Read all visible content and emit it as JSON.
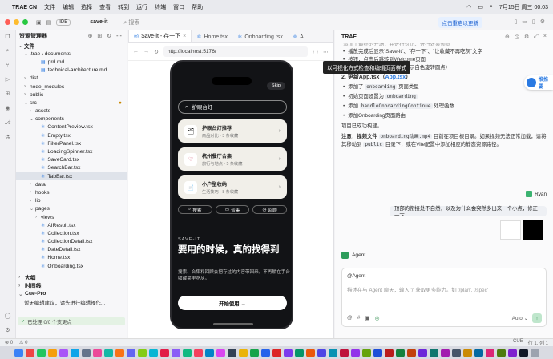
{
  "menubar": {
    "app": "TRAE CN",
    "items": [
      "文件",
      "编辑",
      "选择",
      "查看",
      "转到",
      "运行",
      "终端",
      "窗口",
      "帮助"
    ],
    "datetime": "7月15日 周三 00:03"
  },
  "titlebar": {
    "ide": "IDE",
    "project": "save-it",
    "search": "搜索",
    "update": "点击重启以更新"
  },
  "explorer": {
    "title": "资源管理器",
    "rows": [
      {
        "label": "文件",
        "depth": 0,
        "caret": "⌄",
        "type": "section"
      },
      {
        "label": ".trae \\ documents",
        "depth": 1,
        "caret": "⌄",
        "type": "folder"
      },
      {
        "label": "prd.md",
        "depth": 3,
        "caret": "",
        "type": "md"
      },
      {
        "label": "technical-architecture.md",
        "depth": 3,
        "caret": "",
        "type": "md"
      },
      {
        "label": "dist",
        "depth": 1,
        "caret": "›",
        "type": "folder"
      },
      {
        "label": "node_modules",
        "depth": 1,
        "caret": "›",
        "type": "folder"
      },
      {
        "label": "public",
        "depth": 1,
        "caret": "›",
        "type": "folder"
      },
      {
        "label": "src",
        "depth": 1,
        "caret": "⌄",
        "type": "folder",
        "modified": true
      },
      {
        "label": "assets",
        "depth": 2,
        "caret": "›",
        "type": "folder"
      },
      {
        "label": "components",
        "depth": 2,
        "caret": "⌄",
        "type": "folder"
      },
      {
        "label": "ContentPreview.tsx",
        "depth": 3,
        "caret": "",
        "type": "tsx"
      },
      {
        "label": "Empty.tsx",
        "depth": 3,
        "caret": "",
        "type": "tsx"
      },
      {
        "label": "FilterPanel.tsx",
        "depth": 3,
        "caret": "",
        "type": "tsx"
      },
      {
        "label": "LoadingSpinner.tsx",
        "depth": 3,
        "caret": "",
        "type": "tsx"
      },
      {
        "label": "SaveCard.tsx",
        "depth": 3,
        "caret": "",
        "type": "tsx"
      },
      {
        "label": "SearchBar.tsx",
        "depth": 3,
        "caret": "",
        "type": "tsx"
      },
      {
        "label": "TabBar.tsx",
        "depth": 3,
        "caret": "",
        "type": "tsx",
        "selected": true
      },
      {
        "label": "data",
        "depth": 2,
        "caret": "›",
        "type": "folder"
      },
      {
        "label": "hooks",
        "depth": 2,
        "caret": "›",
        "type": "folder"
      },
      {
        "label": "lib",
        "depth": 2,
        "caret": "›",
        "type": "folder"
      },
      {
        "label": "pages",
        "depth": 2,
        "caret": "⌄",
        "type": "folder"
      },
      {
        "label": "views",
        "depth": 3,
        "caret": "›",
        "type": "folder"
      },
      {
        "label": "AIResult.tsx",
        "depth": 3,
        "caret": "",
        "type": "tsx"
      },
      {
        "label": "Collection.tsx",
        "depth": 3,
        "caret": "",
        "type": "tsx"
      },
      {
        "label": "CollectionDetail.tsx",
        "depth": 3,
        "caret": "",
        "type": "tsx"
      },
      {
        "label": "DateDetail.tsx",
        "depth": 3,
        "caret": "",
        "type": "tsx"
      },
      {
        "label": "Home.tsx",
        "depth": 3,
        "caret": "",
        "type": "tsx"
      },
      {
        "label": "Onboarding.tsx",
        "depth": 3,
        "caret": "",
        "type": "tsx"
      }
    ],
    "outline": "大纲",
    "timeline": "时间线",
    "cue": "Cue-Pro",
    "cue_note": "暂无编辑建议，请先进行编辑操作...",
    "cue_status": "已处理 0/0 个变更点"
  },
  "editor": {
    "tabs": [
      {
        "label": "Save-it - 存一下",
        "active": true
      },
      {
        "label": "Home.tsx",
        "active": false
      },
      {
        "label": "Onboarding.tsx",
        "active": false
      },
      {
        "label": "A",
        "active": false
      }
    ],
    "url": "http://localhost:5176/",
    "tooltip": "以可视化方式检查和编辑页面样式"
  },
  "phone": {
    "skip": "Skip",
    "search": "护眼台灯",
    "cards": [
      {
        "icon": "🗂",
        "title": "护眼台灯推荐",
        "sub": "商品对比 · 3 条收藏"
      },
      {
        "icon": "♡",
        "title": "杭州餐厅合集",
        "sub": "旅行与地点 · 5 条收藏"
      },
      {
        "icon": "📄",
        "title": "小户型收纳",
        "sub": "生活技巧 · 8 条收藏"
      }
    ],
    "buttons": [
      {
        "icon": "⌕",
        "label": "搜索"
      },
      {
        "icon": "▭",
        "label": "合集"
      },
      {
        "icon": "◷",
        "label": "回顾"
      }
    ],
    "tag": "SAVE-IT",
    "title": "要用的时候，真的找得到",
    "desc": "搜索、合集和回顾会把存过的内容带回来。不再躺在手台收藏夹里吃灰。",
    "start": "开始使用 →"
  },
  "chat": {
    "title": "TRAE",
    "top_cut": "添加了最终的开场，并进行对比、进行效果预览",
    "bullets1": [
      "播放完成后显示\"Save-it\"、\"存一下\"、\"让收藏不再吃灰\"文字",
      "按钮，点击后跳转到Welcome页面",
      "添加了加载动画（播放时显示白色旋转圆点）"
    ],
    "section2_title": "2. 更新App.tsx（",
    "section2_link": "App.tsx",
    "section2_end": "）",
    "bullets2": [
      {
        "pre": "添加了 ",
        "code": "onboarding",
        "post": " 页面类型"
      },
      {
        "pre": "初始页面设置为 ",
        "code": "onboarding",
        "post": ""
      },
      {
        "pre": "添加 ",
        "code": "handleOnboardingContinue",
        "post": " 处理函数"
      },
      {
        "pre": "添加Onboarding页面路由",
        "code": "",
        "post": ""
      }
    ],
    "done": "项目已成功构建。",
    "note_pre": "注意：视频文件 ",
    "note_code1": "onboarding动画.mp4",
    "note_mid": " 目前在项目根目录。如果视频无法正常加载，请将其移动到 ",
    "note_code2": "public",
    "note_end": " 目录下，或在Vite配置中添加相应的静态资源路径。",
    "side_pill": "推推要",
    "user": "Ryan",
    "user_msg": "顶部的衔接处不自然，以及为什么会突然多出来一个小点，修正一下",
    "agent": "Agent",
    "input_at": "@Agent",
    "input_placeholder": "描述在与 Agent 聊天，输入 '/' 获取更多能力。如 '/plan', '/spec'",
    "model": "Auto",
    "send": "↑"
  },
  "statusbar": {
    "left": [
      "⊗ 0",
      "⚠ 0"
    ],
    "right": [
      "CUE",
      "行 1, 列 1"
    ]
  },
  "colors": {
    "accent": "#2a7ae2",
    "traffic_red": "#ff5f57",
    "traffic_yellow": "#febc2e",
    "traffic_green": "#28c840"
  }
}
